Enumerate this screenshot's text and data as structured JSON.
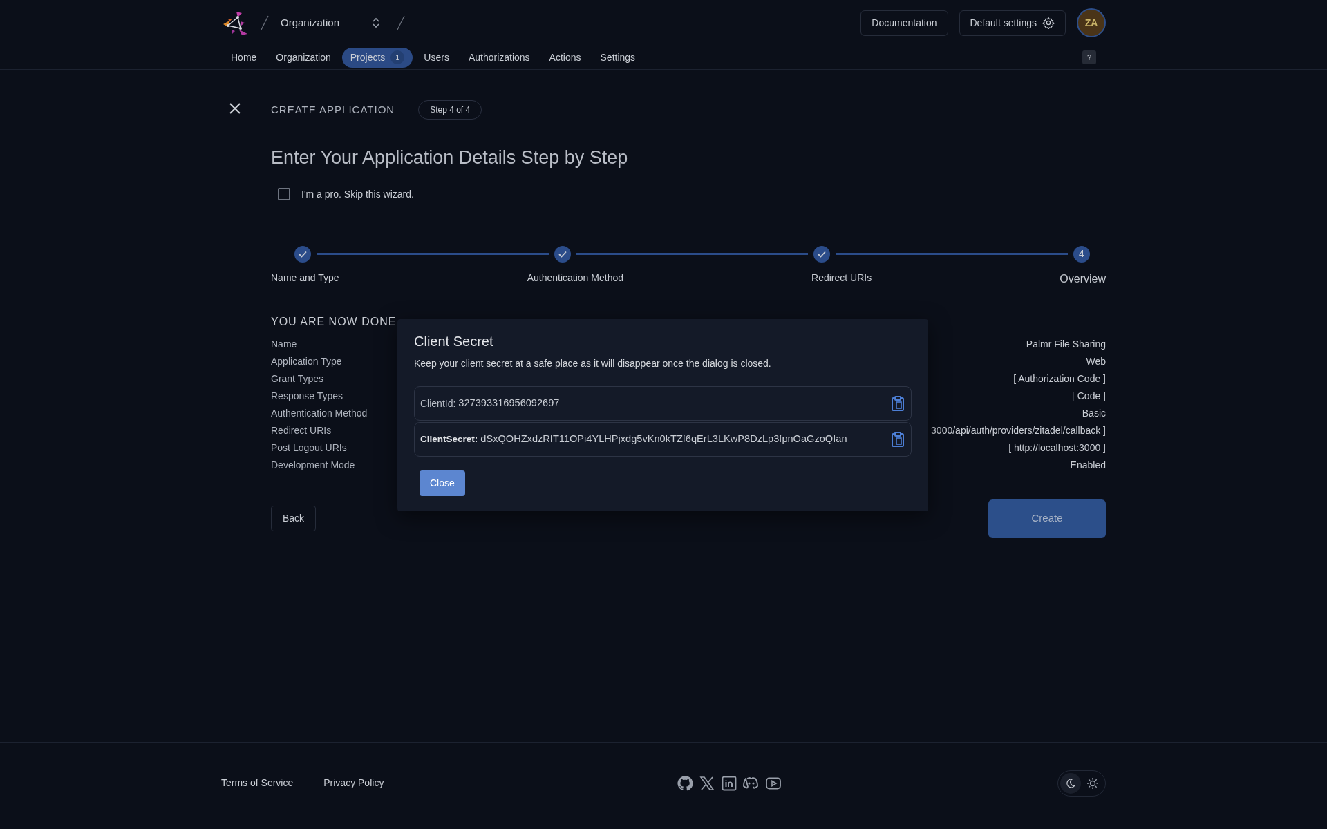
{
  "header": {
    "breadcrumb": "Organization",
    "buttons": [
      "Documentation",
      "Default settings"
    ],
    "avatar": "ZA",
    "help": "?"
  },
  "nav": [
    {
      "label": "Home",
      "selected": false
    },
    {
      "label": "Organization",
      "selected": false
    },
    {
      "label": "Projects",
      "selected": true,
      "count": "1"
    },
    {
      "label": "Users",
      "selected": false
    },
    {
      "label": "Authorizations",
      "selected": false
    },
    {
      "label": "Actions",
      "selected": false
    },
    {
      "label": "Settings",
      "selected": false
    }
  ],
  "wizard": {
    "title": "CREATE APPLICATION",
    "step_badge": "Step 4 of 4",
    "heading": "Enter Your Application Details Step by Step",
    "skip": {
      "label": "I'm a pro. Skip this wizard.",
      "checked": false
    },
    "steps": [
      {
        "label": "Name and Type",
        "completed": true
      },
      {
        "label": "Authentication Method",
        "completed": true
      },
      {
        "label": "Redirect URIs",
        "completed": true
      },
      {
        "label": "Overview",
        "completed": false,
        "number": "4"
      }
    ],
    "overview_title": "YOU ARE NOW DONE.",
    "overview": [
      {
        "label": "Name",
        "value": "Palmr File Sharing"
      },
      {
        "label": "Application Type",
        "value": "Web"
      },
      {
        "label": "Grant Types",
        "value": "[ Authorization Code ]"
      },
      {
        "label": "Response Types",
        "value": "[ Code ]"
      },
      {
        "label": "Authentication Method",
        "value": "Basic"
      },
      {
        "label": "Redirect URIs",
        "value": "3000/api/auth/providers/zitadel/callback ]"
      },
      {
        "label": "Post Logout URIs",
        "value": "[ http://localhost:3000 ]"
      },
      {
        "label": "Development Mode",
        "value": "Enabled"
      }
    ],
    "back": "Back",
    "create": "Create"
  },
  "dialog": {
    "title": "Client Secret",
    "message": "Keep your client secret at a safe place as it will disappear once the dialog is closed.",
    "fields": [
      {
        "label": "ClientId:",
        "value": "327393316956092697",
        "emphasized": false
      },
      {
        "label": "ClientSecret:",
        "value": "dSxQOHZxdzRfT11OPi4YLHPjxdg5vKn0kTZf6qErL3LKwP8DzLp3fpnOaGzoQIan",
        "emphasized": true
      }
    ],
    "close": "Close"
  },
  "footer": {
    "links": [
      "Terms of Service",
      "Privacy Policy"
    ],
    "theme_toggle": [
      {
        "kind": "dark",
        "selected": true
      },
      {
        "kind": "light",
        "selected": false
      }
    ]
  }
}
